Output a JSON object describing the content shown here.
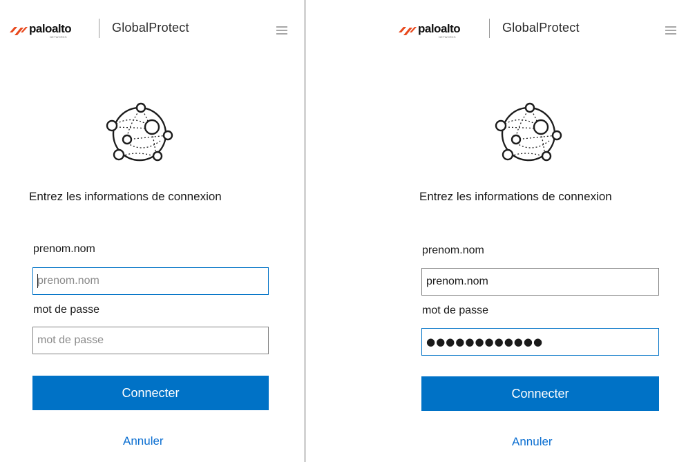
{
  "brand": {
    "logo_text": "paloalto",
    "logo_subtext": "NETWORKS",
    "product_name": "GlobalProtect",
    "accent_color": "#0072c6",
    "logo_color": "#e8481c"
  },
  "panels": [
    {
      "prompt": "Entrez les informations de connexion",
      "username_label": "prenom.nom",
      "username_placeholder": "prenom.nom",
      "username_value": "",
      "password_label": "mot de passe",
      "password_placeholder": "mot de passe",
      "password_value": "",
      "focused_field": "username",
      "connect_label": "Connecter",
      "cancel_label": "Annuler"
    },
    {
      "prompt": "Entrez les informations de connexion",
      "username_label": "prenom.nom",
      "username_placeholder": "prenom.nom",
      "username_value": "prenom.nom",
      "password_label": "mot de passe",
      "password_placeholder": "mot de passe",
      "password_value": "●●●●●●●●●●●●",
      "focused_field": "password",
      "connect_label": "Connecter",
      "cancel_label": "Annuler"
    }
  ]
}
